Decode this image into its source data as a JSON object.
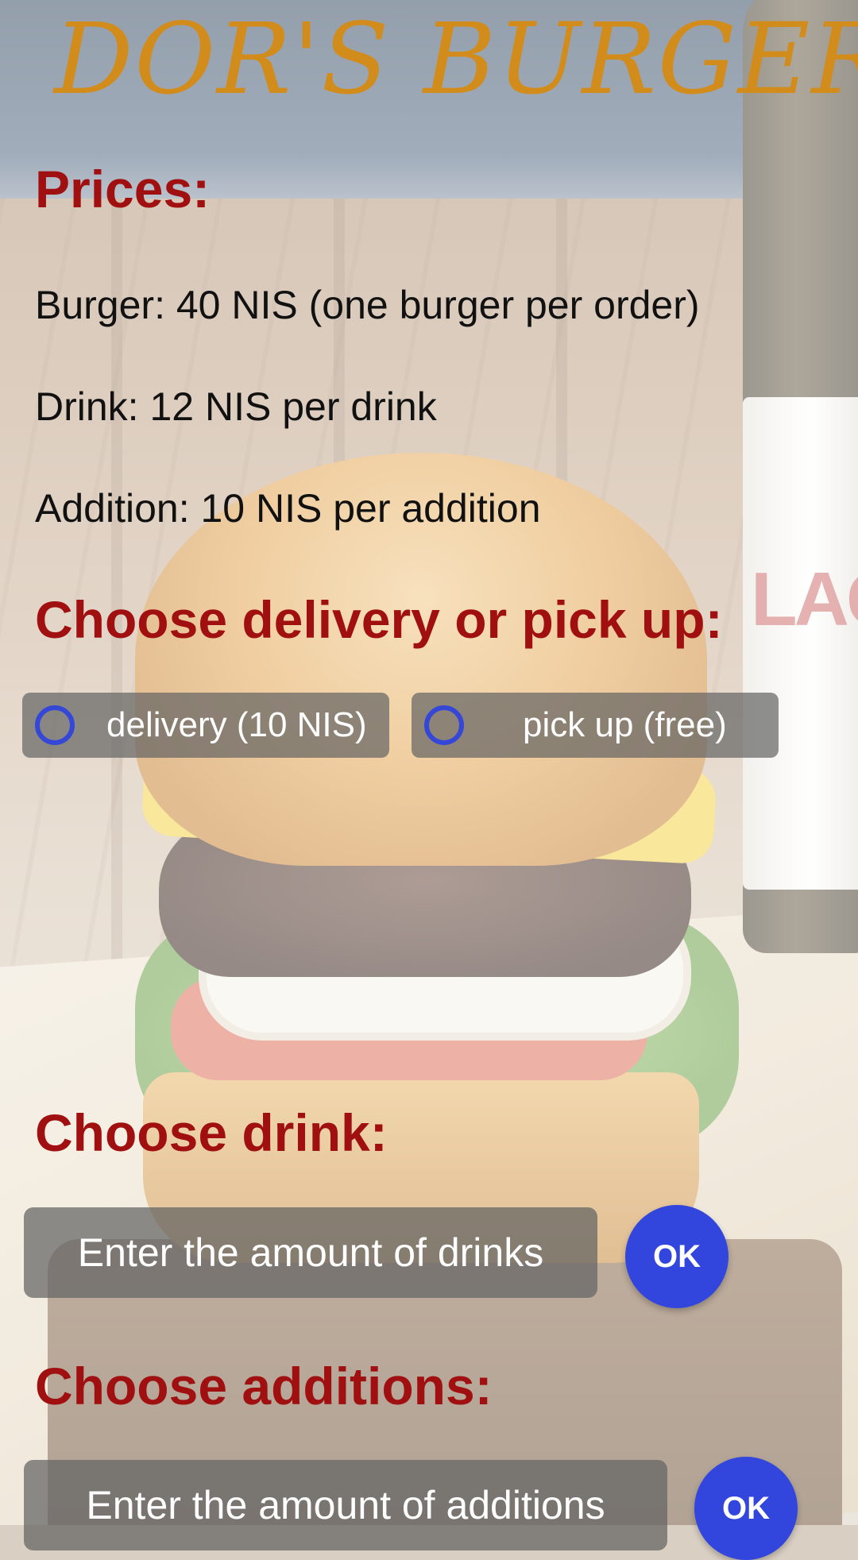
{
  "app": {
    "title": "DOR'S BURGER"
  },
  "prices": {
    "heading": "Prices:",
    "burger": "Burger: 40 NIS (one burger per order)",
    "drink": "Drink: 12 NIS per drink",
    "addition": "Addition: 10 NIS per addition"
  },
  "delivery": {
    "heading": "Choose delivery or pick up:",
    "options": [
      {
        "label": "delivery (10 NIS)",
        "selected": false
      },
      {
        "label": "pick up (free)",
        "selected": false
      }
    ]
  },
  "drink": {
    "heading": "Choose drink:",
    "placeholder": "Enter the amount of drinks",
    "button": "OK"
  },
  "additions": {
    "heading": "Choose additions:",
    "placeholder": "Enter the amount of additions",
    "button": "OK"
  },
  "colors": {
    "title": "#d28c1c",
    "heading": "#a01010",
    "accent": "#3246dd",
    "field": "#626262"
  },
  "background": {
    "image": "burger-photo",
    "bottle_label_text": "LAGER"
  }
}
